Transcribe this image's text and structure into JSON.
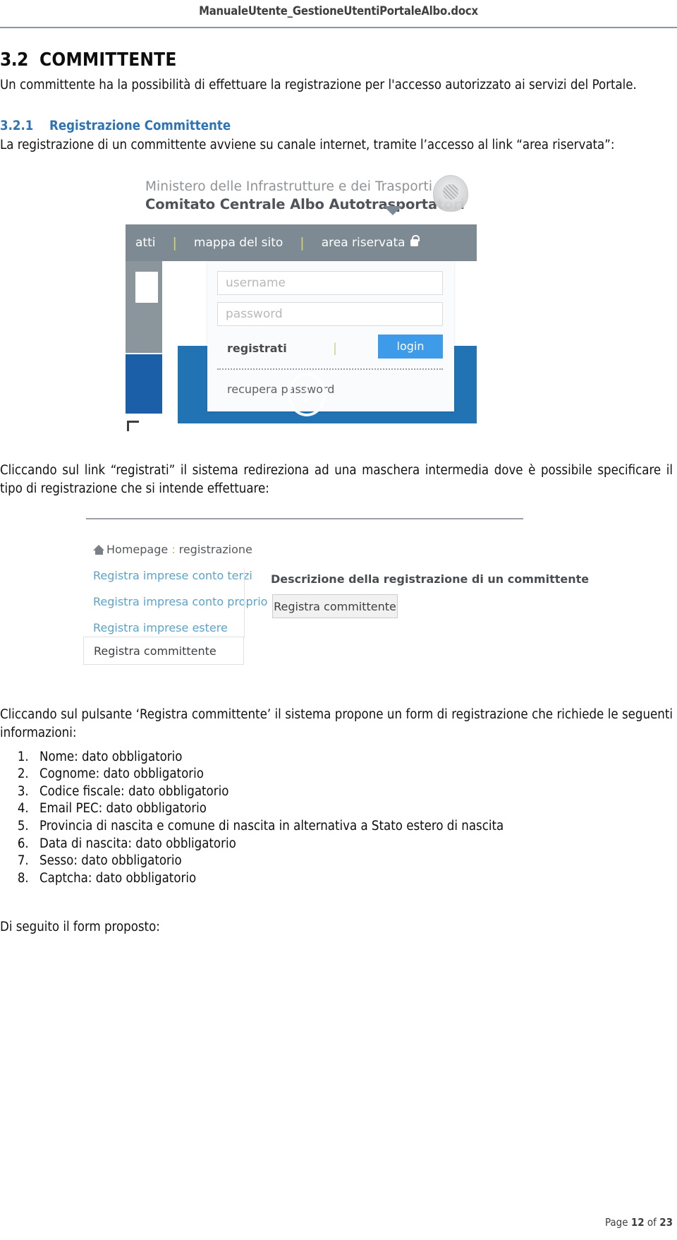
{
  "header": {
    "document_title": "ManualeUtente_GestioneUtentiPortaleAlbo.docx"
  },
  "section": {
    "number": "3.2",
    "title": "COMMITTENTE",
    "intro": "Un committente ha la possibilità di effettuare la registrazione per l'accesso autorizzato ai servizi del Portale."
  },
  "subsection": {
    "number": "3.2.1",
    "title": "Registrazione Committente",
    "intro": "La registrazione di un committente avviene su canale internet, tramite l’accesso al link “area riservata”:"
  },
  "screenshot_login": {
    "brand_line1": "Ministero delle Infrastrutture e dei Trasporti",
    "brand_line2": "Comitato Centrale Albo Autotrasportatori",
    "emblem_icon": "republic-emblem-icon",
    "nav": {
      "item_contatti": "atti",
      "separator": "|",
      "item_mappa": "mappa del sito",
      "item_area_riservata": "area riservata",
      "lock_icon": "lock-icon"
    },
    "form": {
      "username_placeholder": "username",
      "password_placeholder": "password",
      "register_link": "registrati",
      "separator": "|",
      "login_button": "login",
      "recover_link": "recupera password"
    },
    "info_icon_glyph": "i",
    "colors": {
      "navbar": "#7d8a93",
      "login_button": "#3d9be9",
      "blue_panel": "#2273b4",
      "side_blue": "#1b5fa8"
    }
  },
  "paragraph_after_login": "Cliccando sul link “registrati” il sistema redireziona ad una maschera intermedia dove è possibile specificare il tipo di registrazione che si intende effettuare:",
  "screenshot_registration": {
    "breadcrumb": {
      "home_icon": "home-icon",
      "home_label": "Homepage",
      "separator": ":",
      "current": "registrazione"
    },
    "links": [
      "Registra imprese conto terzi",
      "Registra impresa conto proprio",
      "Registra imprese estere"
    ],
    "selected_item": "Registra committente",
    "description_title": "Descrizione della registrazione di un committente",
    "action_button": "Registra committente"
  },
  "paragraph_after_registration": "Cliccando sul pulsante ‘Registra committente’ il sistema propone un form di registrazione che richiede le seguenti informazioni:",
  "required_fields": [
    "Nome: dato obbligatorio",
    "Cognome: dato obbligatorio",
    "Codice fiscale: dato obbligatorio",
    "Email PEC: dato obbligatorio",
    "Provincia di nascita e comune di nascita in alternativa a Stato estero di nascita",
    "Data di nascita: dato obbligatorio",
    "Sesso: dato obbligatorio",
    "Captcha: dato obbligatorio"
  ],
  "closing_paragraph": "Di seguito il form proposto:",
  "footer": {
    "page_prefix": "Page ",
    "page_number": "12",
    "page_mid": " of ",
    "page_total": "23"
  }
}
